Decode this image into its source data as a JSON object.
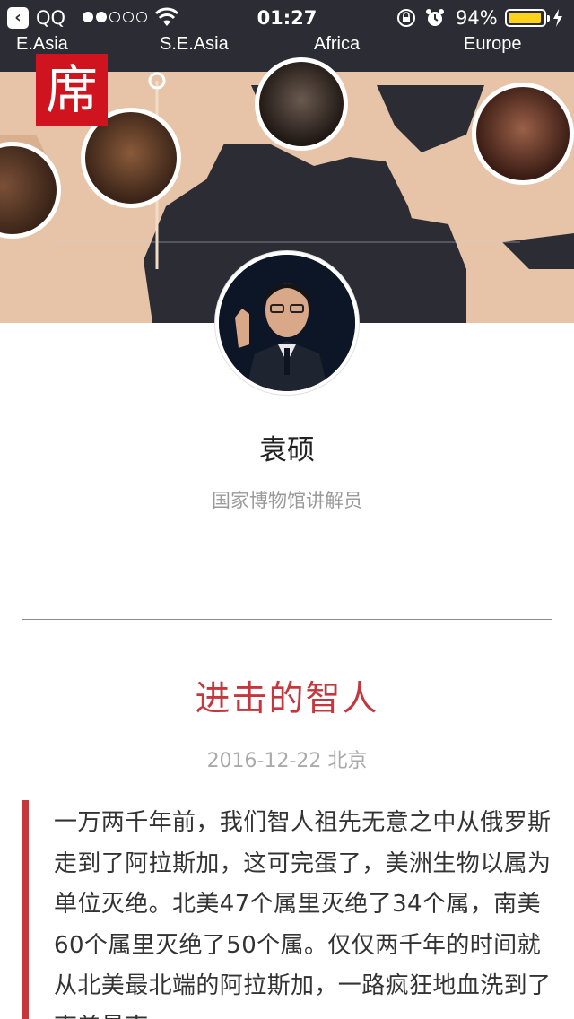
{
  "status_bar": {
    "back_app": "QQ",
    "signal_bars_filled": 2,
    "signal_bars_total": 5,
    "time": "01:27",
    "battery_percent": "94%",
    "battery_level": 0.94,
    "battery_color": "#ffd21a"
  },
  "hero": {
    "regions": [
      "E.Asia",
      "S.E.Asia",
      "Africa",
      "Europe"
    ],
    "logo_char": "席",
    "logo_color": "#d0141f"
  },
  "profile": {
    "name": "袁硕",
    "title": "国家博物馆讲解员"
  },
  "article": {
    "title": "进击的智人",
    "meta": "2016-12-22 北京",
    "accent_color": "#c6373d",
    "body": "一万两千年前，我们智人祖先无意之中从俄罗斯走到了阿拉斯加，这可完蛋了，美洲生物以属为单位灭绝。北美47个属里灭绝了34个属，南美60个属里灭绝了50个属。仅仅两千年的时间就从北美最北端的阿拉斯加，一路疯狂地血洗到了南美最南"
  }
}
